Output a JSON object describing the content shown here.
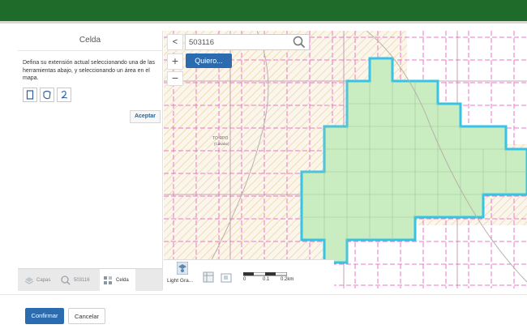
{
  "header": {
    "color": "#1f6b2a"
  },
  "panel": {
    "title": "Celda",
    "description": "Defina su extensión actual seleccionando una de las herramientas abajo, y seleccionando un área en el mapa.",
    "tools": [
      "rectangle-icon",
      "freehand-polygon-icon",
      "freehand-line-icon"
    ],
    "accept_label": "Aceptar"
  },
  "tabs": [
    {
      "label": "Capas",
      "icon": "layers-icon"
    },
    {
      "label": "503116",
      "icon": "search-results-icon"
    },
    {
      "label": "Celda",
      "icon": "cell-select-icon"
    }
  ],
  "map": {
    "search_value": "503116",
    "quiero_label": "Quiero...",
    "collapse_label": "<",
    "zoom_in_label": "+",
    "zoom_out_label": "−",
    "basemap_label": "Light Gra...",
    "scale_labels": [
      "0",
      "0.1",
      "0.2km"
    ],
    "place_label": [
      "TO-RPO",
      "(Casabe)"
    ],
    "selection_fill": "#c9ecc0",
    "selection_stroke": "#37c3e6",
    "grid_color": "#e879c8"
  },
  "footer": {
    "confirm_label": "Confirmar",
    "cancel_label": "Cancelar"
  }
}
